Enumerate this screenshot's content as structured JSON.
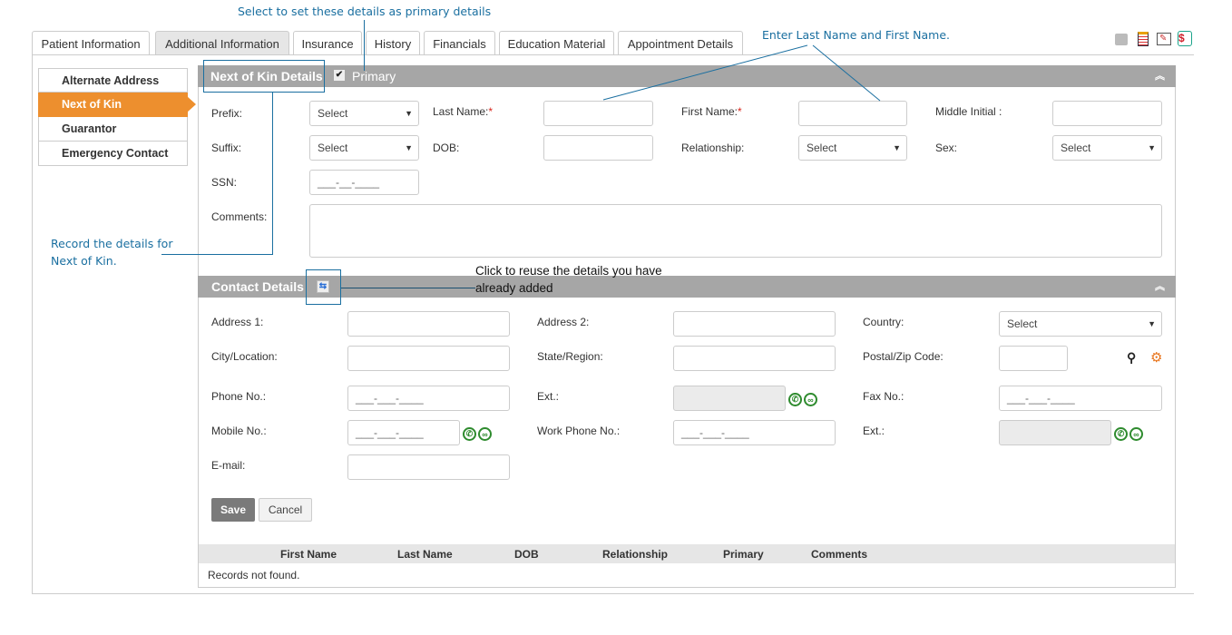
{
  "tabs": [
    "Patient Information",
    "Additional Information",
    "Insurance",
    "History",
    "Financials",
    "Education Material",
    "Appointment Details"
  ],
  "active_tab": "Additional Information",
  "toolbar_icons": [
    "notes-icon",
    "clipboard-icon",
    "pdf-report-icon",
    "billing-icon"
  ],
  "sidenav": [
    "Alternate Address",
    "Next of Kin",
    "Guarantor",
    "Emergency Contact"
  ],
  "active_nav": "Next of Kin",
  "kin": {
    "title": "Next of Kin Details",
    "primary_label": "Primary",
    "primary_checked": true,
    "prefix": "Prefix:",
    "prefix_value": "Select",
    "last_name": "Last Name:",
    "first_name": "First Name:",
    "middle_initial": "Middle Initial :",
    "suffix": "Suffix:",
    "suffix_value": "Select",
    "dob": "DOB:",
    "relationship": "Relationship:",
    "relationship_value": "Select",
    "sex": "Sex:",
    "sex_value": "Select",
    "ssn": "SSN:",
    "ssn_mask": "___-__-____",
    "comments": "Comments:",
    "required_mark": "*"
  },
  "contact": {
    "title": "Contact Details",
    "address1": "Address 1:",
    "address2": "Address 2:",
    "country": "Country:",
    "country_value": "Select",
    "city": "City/Location:",
    "state": "State/Region:",
    "postal": "Postal/Zip Code:",
    "phone": "Phone No.:",
    "phone_mask": "___-___-____",
    "ext": "Ext.:",
    "fax": "Fax No.:",
    "mobile": "Mobile No.:",
    "work_phone": "Work Phone No.:",
    "email": "E-mail:",
    "save": "Save",
    "cancel": "Cancel"
  },
  "table": {
    "columns": [
      "First Name",
      "Last Name",
      "DOB",
      "Relationship",
      "Primary",
      "Comments"
    ],
    "empty": "Records not found."
  },
  "annotations": {
    "primary": "Select to set these details as primary details",
    "names": "Enter Last Name and First Name.",
    "record_line1": "Record the details for",
    "record_line2": "Next of Kin.",
    "reuse_line1": "Click to reuse the details you have",
    "reuse_line2": "already added"
  },
  "colors": {
    "accent": "#ed8f2e",
    "header": "#a6a6a6",
    "annotation": "#1a6fa0"
  }
}
